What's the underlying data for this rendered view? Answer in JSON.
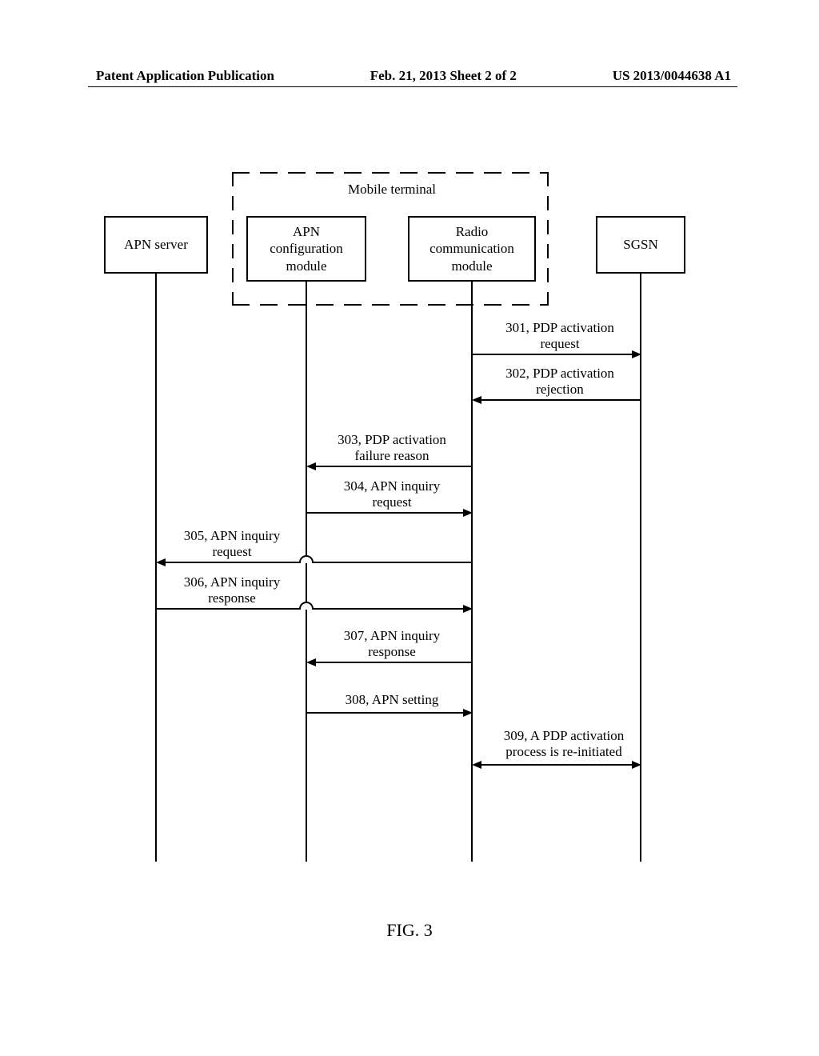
{
  "header": {
    "left": "Patent Application Publication",
    "center": "Feb. 21, 2013  Sheet 2 of 2",
    "right": "US 2013/0044638 A1"
  },
  "actors": {
    "apn_server": "APN server",
    "mobile_terminal_group": "Mobile terminal",
    "apn_config_module_line1": "APN",
    "apn_config_module_line2": "configuration",
    "apn_config_module_line3": "module",
    "radio_module_line1": "Radio",
    "radio_module_line2": "communication",
    "radio_module_line3": "module",
    "sgsn": "SGSN"
  },
  "messages": {
    "m301_line1": "301, PDP activation",
    "m301_line2": "request",
    "m302_line1": "302, PDP activation",
    "m302_line2": "rejection",
    "m303_line1": "303, PDP activation",
    "m303_line2": "failure reason",
    "m304_line1": "304, APN inquiry",
    "m304_line2": "request",
    "m305_line1": "305, APN inquiry",
    "m305_line2": "request",
    "m306_line1": "306, APN inquiry",
    "m306_line2": "response",
    "m307_line1": "307, APN inquiry",
    "m307_line2": "response",
    "m308": "308, APN setting",
    "m309_line1": "309, A PDP activation",
    "m309_line2": "process is re-initiated"
  },
  "figure_label": "FIG. 3"
}
